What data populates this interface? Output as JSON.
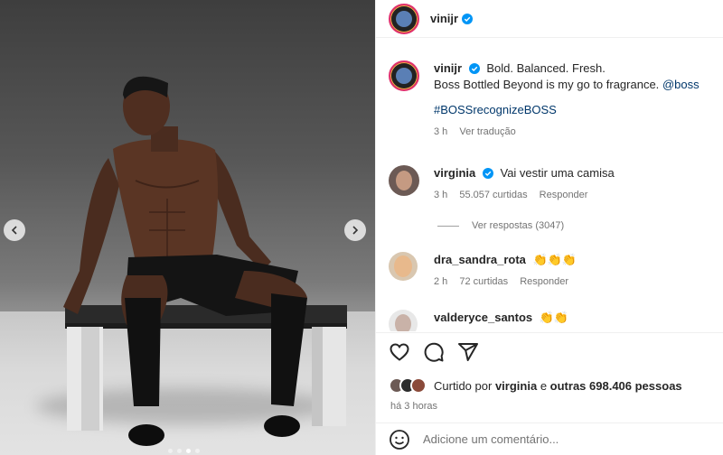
{
  "post": {
    "author": "vinijr",
    "caption_line1": "Bold. Balanced. Fresh.",
    "caption_line2": "Boss Bottled Beyond is my go to fragrance.",
    "caption_mention": "@boss",
    "caption_hashtag": "#BOSSrecognizeBOSS",
    "caption_time": "3 h",
    "translate_label": "Ver tradução"
  },
  "comments": [
    {
      "user": "virginia",
      "text": "Vai vestir uma camisa",
      "time": "3 h",
      "likes": "55.057 curtidas",
      "reply": "Responder"
    },
    {
      "user": "dra_sandra_rota",
      "text": "👏👏👏",
      "time": "2 h",
      "likes": "72 curtidas",
      "reply": "Responder"
    },
    {
      "user": "valderyce_santos",
      "text": "👏👏"
    }
  ],
  "view_replies": "Ver respostas (3047)",
  "likes_summary": {
    "prefix": "Curtido por",
    "user": "virginia",
    "connector": "e",
    "others": "outras 698.406 pessoas"
  },
  "post_time": "há 3 horas",
  "comment_input_placeholder": "Adicione um comentário...",
  "colors": {
    "verified": "#0095f6",
    "ring": "#e1306c"
  },
  "icons": [
    "heart-icon",
    "comment-icon",
    "share-icon",
    "emoji-icon",
    "verified-icon",
    "chevron-left-icon",
    "chevron-right-icon"
  ]
}
